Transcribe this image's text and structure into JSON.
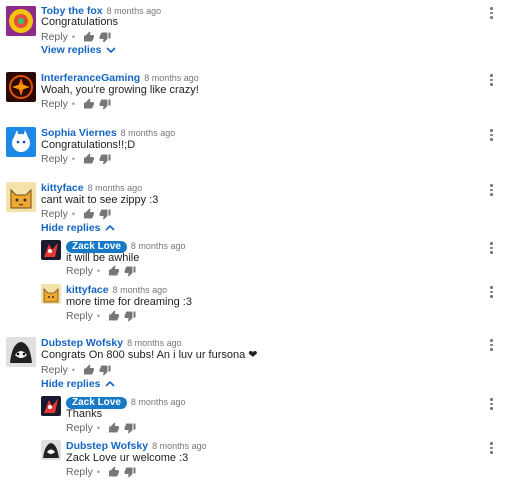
{
  "comments": [
    {
      "author": "Toby the fox",
      "time": "8 months ago",
      "text": "Congratulations",
      "reply": "Reply",
      "toggle": "View replies"
    },
    {
      "author": "InterferanceGaming",
      "time": "8 months ago",
      "text": "Woah, you're growing like crazy!",
      "reply": "Reply"
    },
    {
      "author": "Sophia Viernes",
      "time": "8 months ago",
      "text": "Congratulations!!;D",
      "reply": "Reply"
    },
    {
      "author": "kittyface",
      "time": "8 months ago",
      "text": "cant wait to see zippy :3",
      "reply": "Reply",
      "toggle": "Hide replies",
      "replies": [
        {
          "author": "Zack Love",
          "time": "8 months ago",
          "text": "it will be awhile",
          "reply": "Reply",
          "owner": true
        },
        {
          "author": "kittyface",
          "time": "8 months ago",
          "text": "more time for dreaming :3",
          "reply": "Reply"
        }
      ]
    },
    {
      "author": "Dubstep Wofsky",
      "time": "8 months ago",
      "text": "Congrats On 800 subs! An i luv ur fursona ❤",
      "reply": "Reply",
      "toggle": "Hide replies",
      "replies": [
        {
          "author": "Zack Love",
          "time": "8 months ago",
          "text": "Thanks",
          "reply": "Reply",
          "owner": true
        },
        {
          "author": "Dubstep Wofsky",
          "time": "8 months ago",
          "text": "Zack Love ur welcome :3",
          "reply": "Reply"
        }
      ]
    }
  ],
  "colors": {
    "link": "#1565c0",
    "owner_badge": "#167ac6",
    "meta": "#777777"
  },
  "icons": {
    "like": "thumbs-up-icon",
    "dislike": "thumbs-down-icon",
    "menu": "more-vert-icon"
  }
}
